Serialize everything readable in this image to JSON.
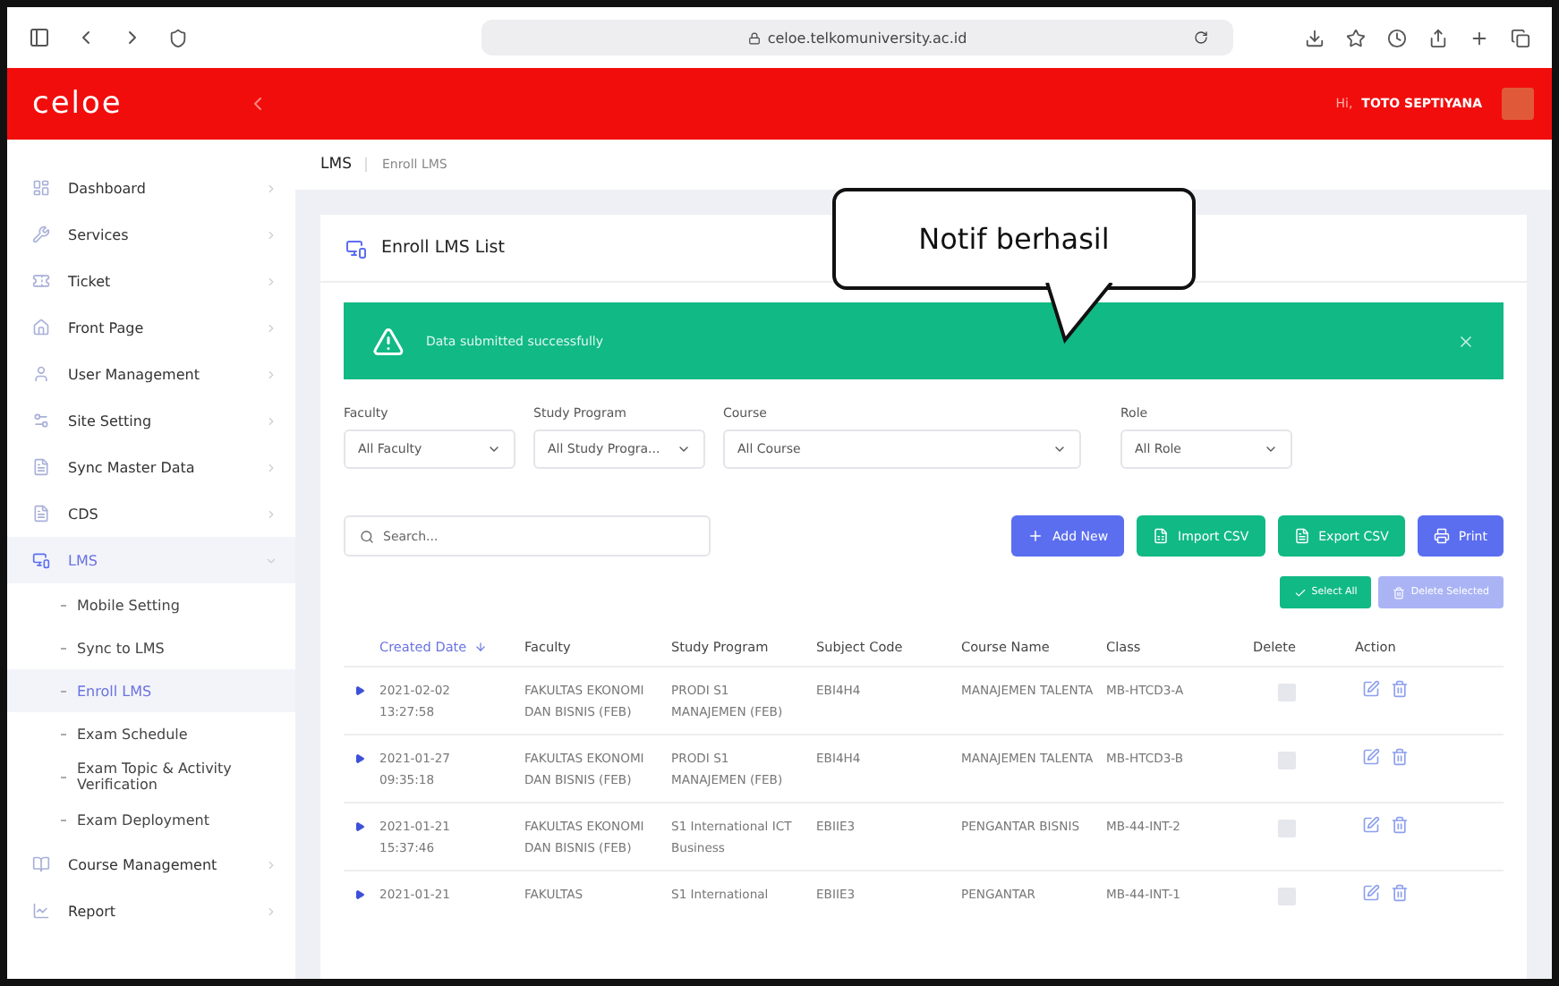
{
  "browser": {
    "url": "celoe.telkomuniversity.ac.id"
  },
  "header": {
    "logo": "celoe",
    "greeting": "Hi,",
    "user": "TOTO SEPTIYANA"
  },
  "sidebar": {
    "items": [
      {
        "label": "Dashboard",
        "expanded": false
      },
      {
        "label": "Services",
        "expanded": false
      },
      {
        "label": "Ticket",
        "expanded": false
      },
      {
        "label": "Front Page",
        "expanded": false
      },
      {
        "label": "User Management",
        "expanded": false
      },
      {
        "label": "Site Setting",
        "expanded": false
      },
      {
        "label": "Sync Master Data",
        "expanded": false
      },
      {
        "label": "CDS",
        "expanded": false
      },
      {
        "label": "LMS",
        "expanded": true,
        "children": [
          {
            "label": "Mobile Setting",
            "selected": false
          },
          {
            "label": "Sync to LMS",
            "selected": false
          },
          {
            "label": "Enroll LMS",
            "selected": true
          },
          {
            "label": "Exam Schedule",
            "selected": false
          },
          {
            "label": "Exam Topic & Activity Verification",
            "selected": false
          },
          {
            "label": "Exam Deployment",
            "selected": false
          }
        ]
      },
      {
        "label": "Course Management",
        "expanded": false
      },
      {
        "label": "Report",
        "expanded": false
      }
    ]
  },
  "breadcrumb": [
    "LMS",
    "Enroll LMS"
  ],
  "card": {
    "title": "Enroll LMS List"
  },
  "alert": {
    "message": "Data submitted successfully"
  },
  "callout": {
    "text": "Notif berhasil"
  },
  "filters": [
    {
      "label": "Faculty",
      "value": "All Faculty"
    },
    {
      "label": "Study Program",
      "value": "All Study Progra..."
    },
    {
      "label": "Course",
      "value": "All Course"
    },
    {
      "label": "Role",
      "value": "All Role"
    }
  ],
  "search": {
    "placeholder": "Search..."
  },
  "buttons": [
    {
      "label": "Add New",
      "kind": "add"
    },
    {
      "label": "Import CSV",
      "kind": "import"
    },
    {
      "label": "Export CSV",
      "kind": "export"
    },
    {
      "label": "Print",
      "kind": "print"
    }
  ],
  "bulk_buttons": [
    {
      "label": "Select All",
      "kind": "select",
      "disabled": false
    },
    {
      "label": "Delete Selected",
      "kind": "delete",
      "disabled": true
    }
  ],
  "table": {
    "columns": [
      {
        "label": "Created Date",
        "sorted": true
      },
      {
        "label": "Faculty",
        "sorted": false
      },
      {
        "label": "Study Program",
        "sorted": false
      },
      {
        "label": "Subject Code",
        "sorted": false
      },
      {
        "label": "Course Name",
        "sorted": false
      },
      {
        "label": "Class",
        "sorted": false
      },
      {
        "label": "Delete",
        "sorted": false
      },
      {
        "label": "Action",
        "sorted": false
      }
    ],
    "rows": [
      {
        "date": "2021-02-02",
        "time": "13:27:58",
        "faculty": "FAKULTAS EKONOMI DAN BISNIS (FEB)",
        "program": "PRODI S1 MANAJEMEN (FEB)",
        "code": "EBI4H4",
        "course": "MANAJEMEN TALENTA",
        "class": "MB-HTCD3-A",
        "checked": false
      },
      {
        "date": "2021-01-27",
        "time": "09:35:18",
        "faculty": "FAKULTAS EKONOMI DAN BISNIS (FEB)",
        "program": "PRODI S1 MANAJEMEN (FEB)",
        "code": "EBI4H4",
        "course": "MANAJEMEN TALENTA",
        "class": "MB-HTCD3-B",
        "checked": false
      },
      {
        "date": "2021-01-21",
        "time": "15:37:46",
        "faculty": "FAKULTAS EKONOMI DAN BISNIS (FEB)",
        "program": "S1 International ICT Business",
        "code": "EBIIE3",
        "course": "PENGANTAR BISNIS",
        "class": "MB-44-INT-2",
        "checked": false
      },
      {
        "date": "2021-01-21",
        "faculty": "FAKULTAS",
        "program": "S1 International",
        "code": "EBIIE3",
        "course": "PENGANTAR",
        "class": "MB-44-INT-1",
        "checked": false
      }
    ]
  }
}
